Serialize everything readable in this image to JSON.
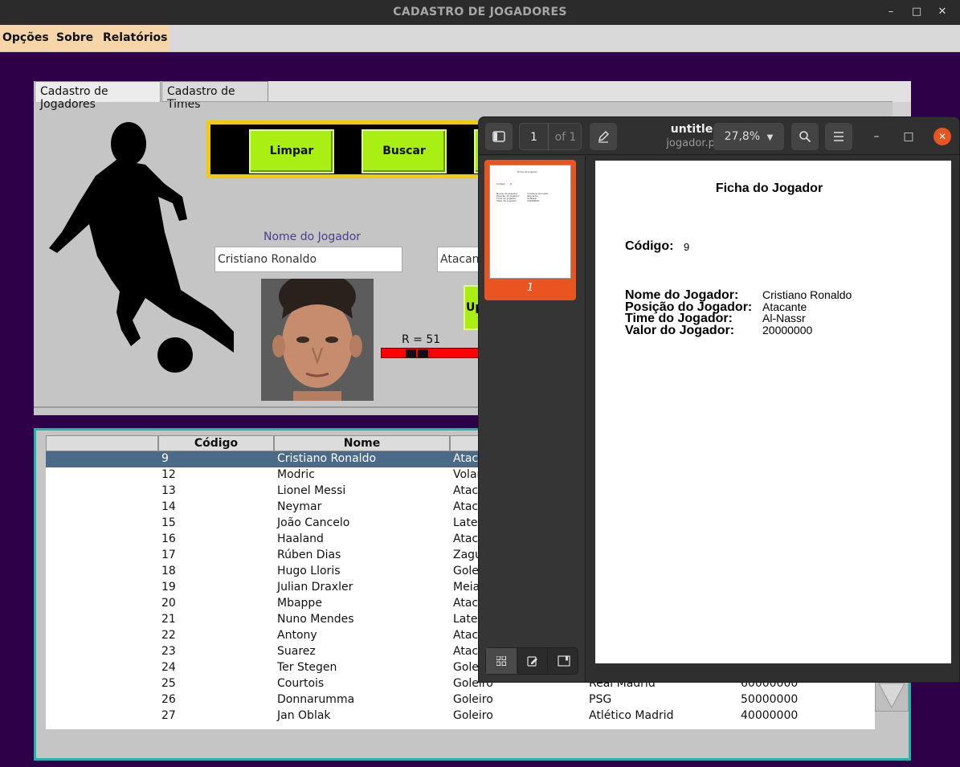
{
  "window": {
    "title": "CADASTRO DE JOGADORES",
    "minimize_glyph": "–",
    "maximize_glyph": "□",
    "close_glyph": "✕"
  },
  "menu": {
    "items": [
      "Opções",
      "Sobre",
      "Relatórios"
    ],
    "bg_color": "#f6d6a7"
  },
  "tabs": [
    "Cadastro de Jogadores",
    "Cadastro de Times"
  ],
  "form": {
    "buttons": {
      "limpar": "Limpar",
      "buscar": "Buscar",
      "update_partial": "Up"
    },
    "nome_label": "Nome do Jogador",
    "nome_value": "Cristiano Ronaldo",
    "posicao_value": "Atacante",
    "r_label": "R = 51",
    "accent_color": "#a9ef14",
    "border_color": "#f2cc00"
  },
  "table": {
    "columns": [
      "",
      "Código",
      "Nome"
    ],
    "selected_index": 0,
    "rows": [
      {
        "codigo": "9",
        "nome": "Cristiano Ronaldo",
        "posicao": "Atacante",
        "time": "",
        "valor": ""
      },
      {
        "codigo": "12",
        "nome": "Modric",
        "posicao": "Volante",
        "time": "",
        "valor": ""
      },
      {
        "codigo": "13",
        "nome": "Lionel Messi",
        "posicao": "Atacante",
        "time": "",
        "valor": ""
      },
      {
        "codigo": "14",
        "nome": "Neymar",
        "posicao": "Atacante",
        "time": "",
        "valor": ""
      },
      {
        "codigo": "15",
        "nome": "João Cancelo",
        "posicao": "Lateral",
        "time": "",
        "valor": ""
      },
      {
        "codigo": "16",
        "nome": "Haaland",
        "posicao": "Atacante",
        "time": "",
        "valor": ""
      },
      {
        "codigo": "17",
        "nome": "Rúben Dias",
        "posicao": "Zagueiro",
        "time": "",
        "valor": ""
      },
      {
        "codigo": "18",
        "nome": "Hugo Lloris",
        "posicao": "Goleiro",
        "time": "",
        "valor": ""
      },
      {
        "codigo": "19",
        "nome": "Julian Draxler",
        "posicao": "Meia",
        "time": "",
        "valor": ""
      },
      {
        "codigo": "20",
        "nome": "Mbappe",
        "posicao": "Atacante",
        "time": "",
        "valor": ""
      },
      {
        "codigo": "21",
        "nome": "Nuno Mendes",
        "posicao": "Lateral",
        "time": "",
        "valor": ""
      },
      {
        "codigo": "22",
        "nome": "Antony",
        "posicao": "Atacante",
        "time": "",
        "valor": ""
      },
      {
        "codigo": "23",
        "nome": "Suarez",
        "posicao": "Atacante",
        "time": "",
        "valor": ""
      },
      {
        "codigo": "24",
        "nome": "Ter Stegen",
        "posicao": "Goleiro",
        "time": "",
        "valor": ""
      },
      {
        "codigo": "25",
        "nome": "Courtois",
        "posicao": "Goleiro",
        "time": "Real Madrid",
        "valor": "60000000"
      },
      {
        "codigo": "26",
        "nome": "Donnarumma",
        "posicao": "Goleiro",
        "time": "PSG",
        "valor": "50000000"
      },
      {
        "codigo": "27",
        "nome": "Jan Oblak",
        "posicao": "Goleiro",
        "time": "Atlético Madrid",
        "valor": "40000000"
      }
    ],
    "selected_color": "#4a6a88",
    "border_color": "#1fb5ad"
  },
  "pdf_viewer": {
    "title": "untitled",
    "filename": "jogador.pdf",
    "page_current": "1",
    "page_total": "of 1",
    "zoom": "27,8%",
    "thumb_label": "1",
    "document": {
      "heading": "Ficha do Jogador",
      "codigo_label": "Código:",
      "codigo_value": "9",
      "fields": [
        {
          "label": "Nome do Jogador:",
          "value": "Cristiano Ronaldo"
        },
        {
          "label": "Posição do Jogador:",
          "value": "Atacante"
        },
        {
          "label": "Time do Jogador:",
          "value": "Al-Nassr"
        },
        {
          "label": "Valor do Jogador:",
          "value": "20000000"
        }
      ]
    },
    "accent_color": "#e95420"
  }
}
